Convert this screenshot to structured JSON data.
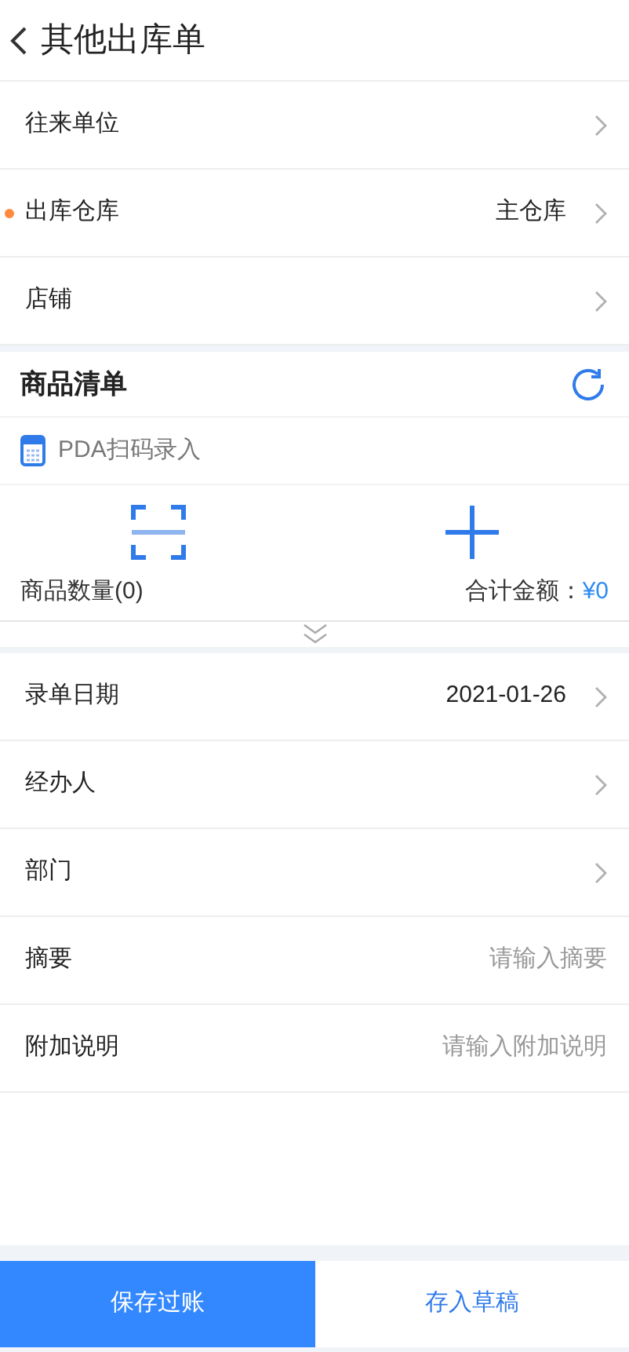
{
  "header": {
    "title": "其他出库单"
  },
  "top_fields": [
    {
      "kind": "select",
      "label": "往来单位",
      "required": false
    },
    {
      "kind": "select",
      "label": "出库仓库",
      "required": true,
      "value": "主仓库"
    },
    {
      "kind": "select",
      "label": "店铺",
      "required": false
    }
  ],
  "goods": {
    "title": "商品清单",
    "pda_label": "PDA扫码录入",
    "quantity": "商品数量(0)",
    "total_label": "合计金额：",
    "total_value": "¥0"
  },
  "bottom_fields": [
    {
      "kind": "select",
      "label": "录单日期",
      "value": "2021-01-26"
    },
    {
      "kind": "select",
      "label": "经办人"
    },
    {
      "kind": "select",
      "label": "部门"
    },
    {
      "kind": "input",
      "label": "摘要",
      "placeholder": "请输入摘要"
    },
    {
      "kind": "input",
      "label": "附加说明",
      "placeholder": "请输入附加说明"
    }
  ],
  "actions": [
    {
      "label": "保存过账",
      "primary": true
    },
    {
      "label": "存入草稿",
      "primary": false
    }
  ]
}
